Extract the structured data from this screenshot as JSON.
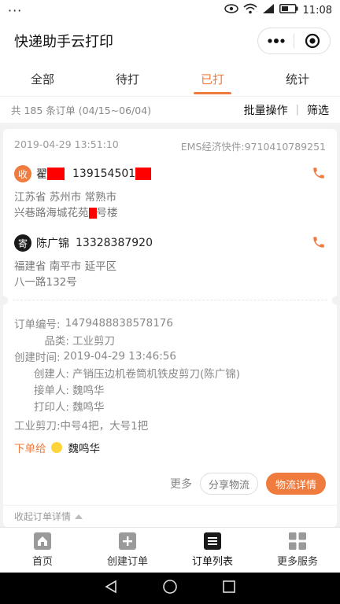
{
  "status_bar": {
    "left_icon": "ellipsis-icon",
    "time": "11:08",
    "icons": [
      "eye-icon",
      "wifi-icon",
      "signal-icon",
      "battery-icon"
    ]
  },
  "app": {
    "title": "快递助手云打印"
  },
  "tabs": [
    {
      "label": "全部",
      "active": false
    },
    {
      "label": "待打",
      "active": false
    },
    {
      "label": "已打",
      "active": true
    },
    {
      "label": "统计",
      "active": false
    }
  ],
  "summary": {
    "count_text": "共 185 条订单 (04/15~06/04)",
    "batch_label": "批量操作",
    "separator": "|",
    "filter_label": "筛选"
  },
  "order": {
    "datetime": "2019-04-29 13:51:10",
    "tracking": "EMS经济快件:9710410789251",
    "sender": {
      "badge": "收",
      "name_prefix": "翟",
      "phone_prefix": "139154501",
      "address_line1": "江苏省 苏州市 常熟市",
      "address_line2_a": "兴巷路海城花苑",
      "address_line2_b": "号楼"
    },
    "receiver": {
      "badge": "寄",
      "name": "陈广锦",
      "phone": "13328387920",
      "address_line1": "福建省 南平市 延平区",
      "address_line2": "八一路132号"
    },
    "details": [
      {
        "key": "订单编号:",
        "value": "1479488838578176"
      },
      {
        "key": "品类:",
        "value": "工业剪刀"
      },
      {
        "key": "创建时间:",
        "value": "2019-04-29 13:46:56"
      },
      {
        "key": "创建人:",
        "value": "产销压边机卷筒机铁皮剪刀(陈广锦)"
      },
      {
        "key": "接单人:",
        "value": "魏鸣华"
      },
      {
        "key": "打印人:",
        "value": "魏鸣华"
      }
    ],
    "item_note": "工业剪刀:中号4把，大号1把",
    "assign_label": "下单给",
    "assign_name": "魏鸣华",
    "more_label": "更多",
    "share_label": "分享物流",
    "logistics_label": "物流详情",
    "collapse_label": "收起订单详情"
  },
  "bottom_nav": [
    {
      "label": "首页",
      "icon": "home-icon",
      "active": false
    },
    {
      "label": "创建订单",
      "icon": "plus-icon",
      "active": false
    },
    {
      "label": "订单列表",
      "icon": "list-icon",
      "active": true
    },
    {
      "label": "更多服务",
      "icon": "grid-icon",
      "active": false
    }
  ],
  "colors": {
    "accent": "#f07b3f",
    "redaction": "#ff0000"
  }
}
